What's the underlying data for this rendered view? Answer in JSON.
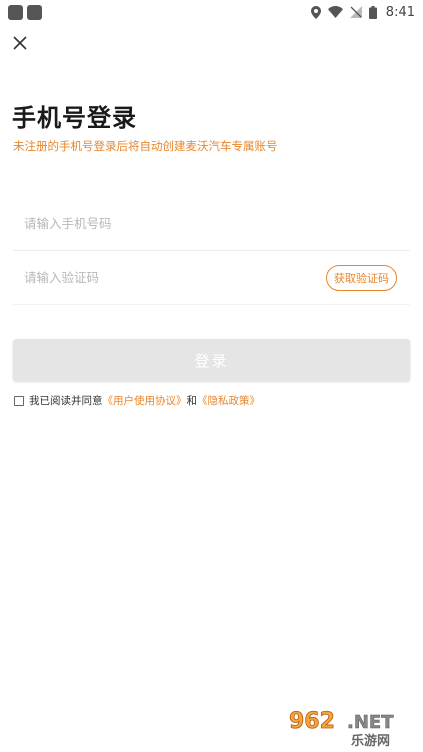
{
  "status_bar": {
    "time": "8:41"
  },
  "header": {
    "title": "手机号登录",
    "subtitle": "未注册的手机号登录后将自动创建麦沃汽车专属账号"
  },
  "form": {
    "phone_placeholder": "请输入手机号码",
    "code_placeholder": "请输入验证码",
    "get_code_label": "获取验证码",
    "login_label": "登录"
  },
  "agreement": {
    "prefix": "我已阅读并同意",
    "terms_link": "《用户使用协议》",
    "and": "和",
    "privacy_link": "《隐私政策》"
  },
  "watermark": {
    "text": "962.NET",
    "subtext": "乐游网"
  },
  "colors": {
    "accent": "#e8862b",
    "button_disabled": "#e5e5e5"
  }
}
